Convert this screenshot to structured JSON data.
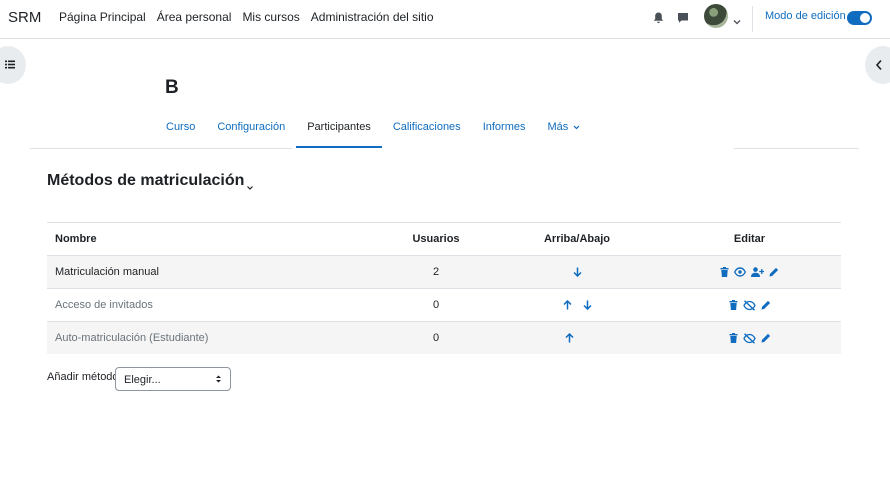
{
  "navbar": {
    "brand": "SRM",
    "links": [
      "Página Principal",
      "Área personal",
      "Mis cursos",
      "Administración del sitio"
    ],
    "edit_mode_label": "Modo de edición"
  },
  "course": {
    "title": "B",
    "tabs": [
      "Curso",
      "Configuración",
      "Participantes",
      "Calificaciones",
      "Informes",
      "Más"
    ]
  },
  "page": {
    "heading": "Métodos de matriculación"
  },
  "table": {
    "headers": [
      "Nombre",
      "Usuarios",
      "Arriba/Abajo",
      "Editar"
    ],
    "rows": [
      {
        "name": "Matriculación manual",
        "users": "2"
      },
      {
        "name": "Acceso de invitados",
        "users": "0"
      },
      {
        "name": "Auto-matriculación (Estudiante)",
        "users": "0"
      }
    ]
  },
  "add_method": {
    "label": "Añadir método",
    "selected": "Elegir..."
  },
  "colors": {
    "accent": "#0f6cbf",
    "text": "#1d2125",
    "muted": "#6a737b"
  }
}
